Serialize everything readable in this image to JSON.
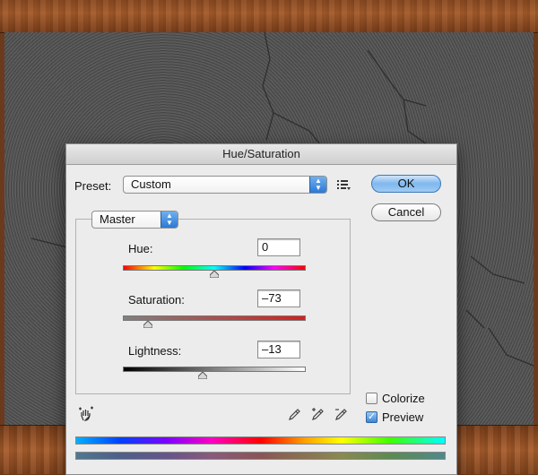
{
  "dialog": {
    "title": "Hue/Saturation",
    "preset_label": "Preset:",
    "preset_value": "Custom",
    "channel_value": "Master",
    "ok_label": "OK",
    "cancel_label": "Cancel",
    "hue_label": "Hue:",
    "hue_value": "0",
    "saturation_label": "Saturation:",
    "saturation_value": "–73",
    "lightness_label": "Lightness:",
    "lightness_value": "–13",
    "colorize_label": "Colorize",
    "preview_label": "Preview",
    "colorize_checked": false,
    "preview_checked": true,
    "hue_level": 0.5,
    "saturation_level": 0.135,
    "lightness_level": 0.435
  },
  "icons": {
    "preset_options": "preset-options-icon",
    "hand_tool": "targeted-adjustment-icon",
    "eyedropper": "eyedropper-icon",
    "eyedropper_add": "eyedropper-plus-icon",
    "eyedropper_subtract": "eyedropper-minus-icon"
  },
  "colors": {
    "default_button": "#7fb8ee",
    "saturation_track_end": "#d4201e"
  }
}
